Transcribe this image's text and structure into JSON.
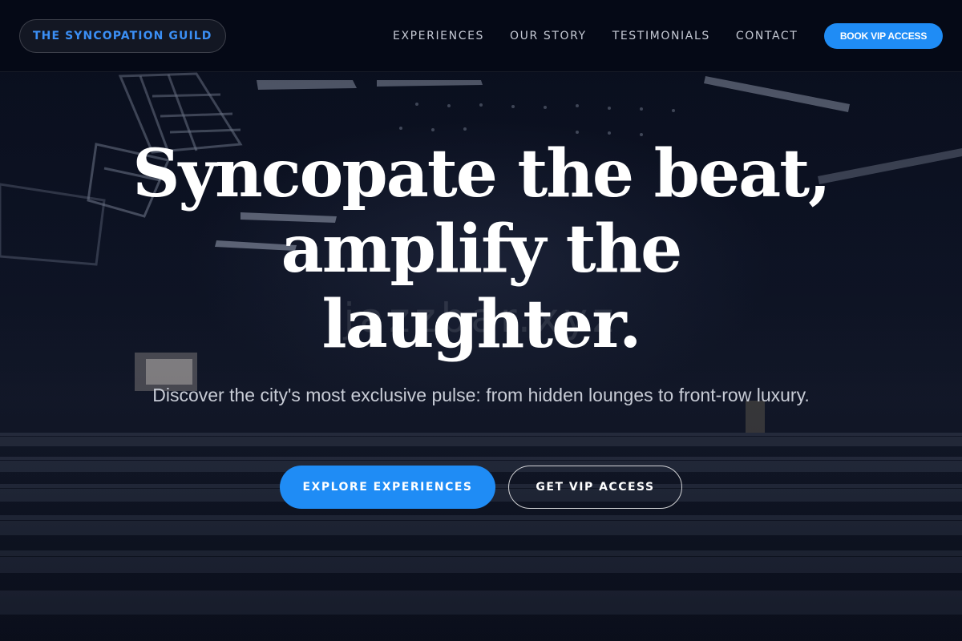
{
  "header": {
    "brand": "THE SYNCOPATION GUILD",
    "nav": [
      {
        "label": "EXPERIENCES"
      },
      {
        "label": "OUR STORY"
      },
      {
        "label": "TESTIMONIALS"
      },
      {
        "label": "CONTACT"
      }
    ],
    "cta_label": "BOOK VIP ACCESS"
  },
  "hero": {
    "title_line1": "Syncopate the beat,",
    "title_line2": "amplify the",
    "title_line3": "laughter.",
    "watermark": "jazzbar.xyz",
    "subtitle": "Discover the city's most exclusive pulse: from hidden lounges to front-row luxury.",
    "primary_cta": "EXPLORE EXPERIENCES",
    "secondary_cta": "GET VIP ACCESS"
  },
  "colors": {
    "accent": "#1f8cf5",
    "brand_text": "#3b8ff5",
    "header_bg": "#050916",
    "page_bg": "#080c1a",
    "nav_text": "#c5c9d4",
    "subtitle_text": "#c8ccd6"
  },
  "background": {
    "description_icon": "concert-hall-photo"
  }
}
